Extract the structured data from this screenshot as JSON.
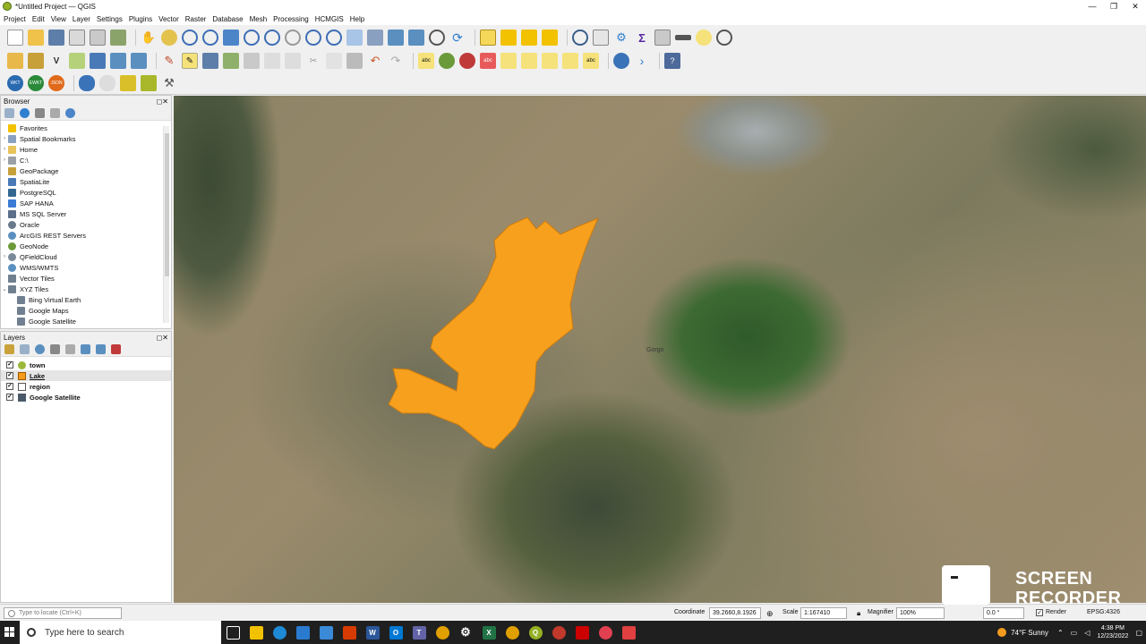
{
  "window": {
    "title": "*Untitled Project — QGIS"
  },
  "menu": [
    "Project",
    "Edit",
    "View",
    "Layer",
    "Settings",
    "Plugins",
    "Vector",
    "Raster",
    "Database",
    "Mesh",
    "Processing",
    "HCMGIS",
    "Help"
  ],
  "browser": {
    "title": "Browser",
    "items": [
      {
        "label": "Favorites",
        "icon": "star-icon",
        "color": "#f2c200",
        "arrow": ""
      },
      {
        "label": "Spatial Bookmarks",
        "icon": "bookmark-icon",
        "color": "#8aa0c0",
        "arrow": "›"
      },
      {
        "label": "Home",
        "icon": "folder-icon",
        "color": "#e8c35a",
        "arrow": "›"
      },
      {
        "label": "C:\\",
        "icon": "drive-icon",
        "color": "#9aa0a6",
        "arrow": "›"
      },
      {
        "label": "GeoPackage",
        "icon": "geopackage-icon",
        "color": "#c7a03a",
        "arrow": ""
      },
      {
        "label": "SpatiaLite",
        "icon": "spatialite-icon",
        "color": "#4a79b8",
        "arrow": ""
      },
      {
        "label": "PostgreSQL",
        "icon": "postgresql-icon",
        "color": "#336791",
        "arrow": ""
      },
      {
        "label": "SAP HANA",
        "icon": "sap-hana-icon",
        "color": "#3a7bd5",
        "arrow": ""
      },
      {
        "label": "MS SQL Server",
        "icon": "mssql-icon",
        "color": "#5b6f8a",
        "arrow": ""
      },
      {
        "label": "Oracle",
        "icon": "oracle-icon",
        "color": "#6a7a8c",
        "arrow": ""
      },
      {
        "label": "ArcGIS REST Servers",
        "icon": "globe-icon",
        "color": "#5a8fc0",
        "arrow": ""
      },
      {
        "label": "GeoNode",
        "icon": "geonode-icon",
        "color": "#6b9a3a",
        "arrow": ""
      },
      {
        "label": "QFieldCloud",
        "icon": "qfieldcloud-icon",
        "color": "#7a8a9a",
        "arrow": "›"
      },
      {
        "label": "WMS/WMTS",
        "icon": "wms-icon",
        "color": "#5a8fc0",
        "arrow": ""
      },
      {
        "label": "Vector Tiles",
        "icon": "vector-tiles-icon",
        "color": "#708090",
        "arrow": ""
      },
      {
        "label": "XYZ Tiles",
        "icon": "xyz-tiles-icon",
        "color": "#708090",
        "arrow": "⌄"
      },
      {
        "label": "Bing Virtual Earth",
        "icon": "tile-icon",
        "color": "#708090",
        "arrow": "",
        "indent": true
      },
      {
        "label": "Google Maps",
        "icon": "tile-icon",
        "color": "#708090",
        "arrow": "",
        "indent": true
      },
      {
        "label": "Google Satellite",
        "icon": "tile-icon",
        "color": "#708090",
        "arrow": "",
        "indent": true
      }
    ]
  },
  "layers": {
    "title": "Layers",
    "items": [
      {
        "label": "town",
        "checked": "✓",
        "color": "#9bb83a",
        "underline": false
      },
      {
        "label": "Lake",
        "checked": "✓",
        "color": "#f59a1b",
        "underline": true
      },
      {
        "label": "region",
        "checked": "✓",
        "color": "#ffffff",
        "underline": false
      },
      {
        "label": "Google Satellite",
        "checked": "✓",
        "color": "#4a5a6a",
        "underline": false
      }
    ]
  },
  "map": {
    "polygon_color": "#f7a01e",
    "place_label": "Gorgo"
  },
  "status": {
    "locate_placeholder": "Type to locate (Ctrl+K)",
    "coordinate_label": "Coordinate",
    "coordinate_value": "39.2660,8.1926",
    "scale_label": "Scale",
    "scale_value": "1:167410",
    "magnifier_label": "Magnifier",
    "magnifier_value": "100%",
    "rotation_value": "0.0 °",
    "render_label": "Render",
    "crs": "EPSG:4326"
  },
  "taskbar": {
    "search_placeholder": "Type here to search",
    "weather": "74°F  Sunny",
    "time": "4:38 PM",
    "date": "12/23/2022"
  },
  "watermark": {
    "line1": "SCREEN",
    "line2": "RECORDER"
  }
}
